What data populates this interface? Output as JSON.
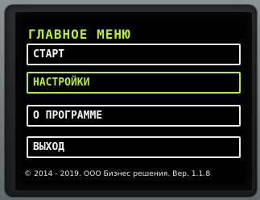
{
  "screen": {
    "title": "ГЛАВНОЕ МЕНЮ",
    "menu": [
      {
        "label": "СТАРТ",
        "selected": false
      },
      {
        "label": "НАСТРОЙКИ",
        "selected": true
      },
      {
        "label": "О ПРОГРАММЕ",
        "selected": false
      },
      {
        "label": "ВЫХОД",
        "selected": false
      }
    ],
    "footer": "© 2014 - 2019. ООО Бизнес решения. Вер. 1.1.8"
  },
  "colors": {
    "accent": "#b7f21e",
    "text": "#f2f4f5",
    "background": "#000000"
  }
}
